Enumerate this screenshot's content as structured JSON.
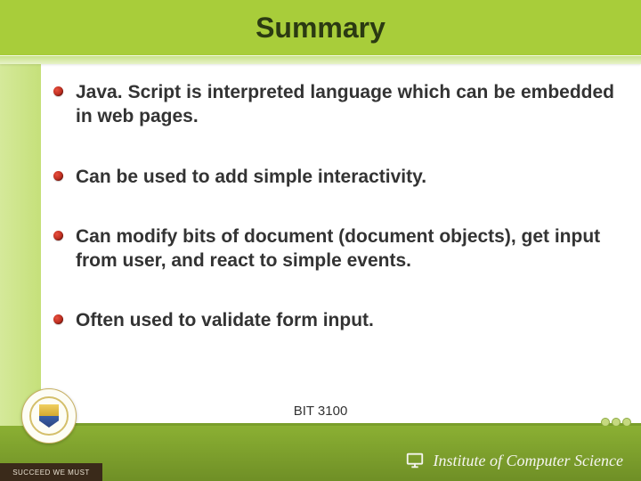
{
  "title": "Summary",
  "bullets": [
    "Java. Script is interpreted language which can be embedded in web pages.",
    "Can be used to add simple interactivity.",
    "Can modify bits of document (document objects), get input from user, and react to simple events.",
    "Often used to validate form input."
  ],
  "footer_code": "BIT 3100",
  "motto": "SUCCEED WE MUST",
  "institute": "Institute of Computer Science"
}
